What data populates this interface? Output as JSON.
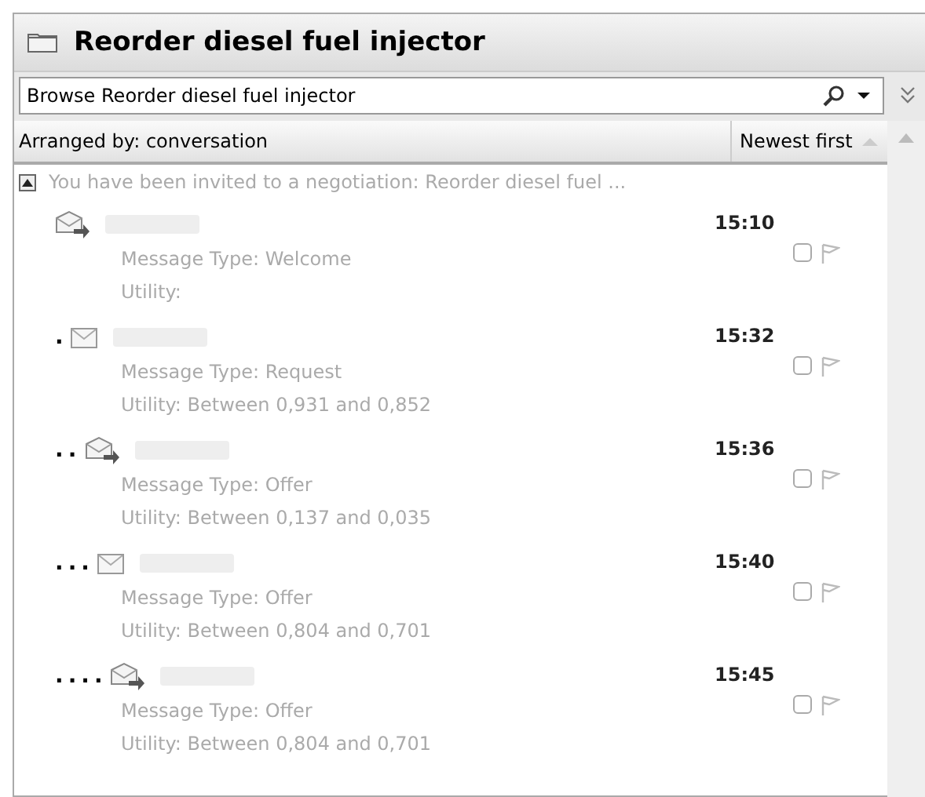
{
  "title": "Reorder diesel fuel injector",
  "search": {
    "value": "Browse Reorder diesel fuel injector"
  },
  "arrangement": {
    "label": "Arranged by: conversation",
    "sort": "Newest first"
  },
  "conversation": {
    "subject": "You have been invited to a negotiation: Reorder diesel fuel ...",
    "expanded": true
  },
  "messages": [
    {
      "kind": "reply",
      "type": "Message Type: Welcome",
      "utility": "Utility:",
      "time": "15:10",
      "flagged": false
    },
    {
      "prefix": ".",
      "kind": "mail",
      "type": "Message Type: Request",
      "utility": "Utility:  Between 0,931 and 0,852",
      "time": "15:32",
      "flagged": false
    },
    {
      "prefix": "..",
      "kind": "reply",
      "type": "Message Type: Offer",
      "utility": "Utility: Between 0,137 and 0,035",
      "time": "15:36",
      "flagged": false
    },
    {
      "prefix": "...",
      "kind": "mail",
      "type": "Message Type: Offer",
      "utility": "Utility: Between 0,804 and 0,701",
      "time": "15:40",
      "flagged": false
    },
    {
      "prefix": "....",
      "kind": "reply",
      "type": "Message Type: Offer",
      "utility": "Utility: Between 0,804 and 0,701",
      "time": "15:45",
      "flagged": false
    }
  ]
}
